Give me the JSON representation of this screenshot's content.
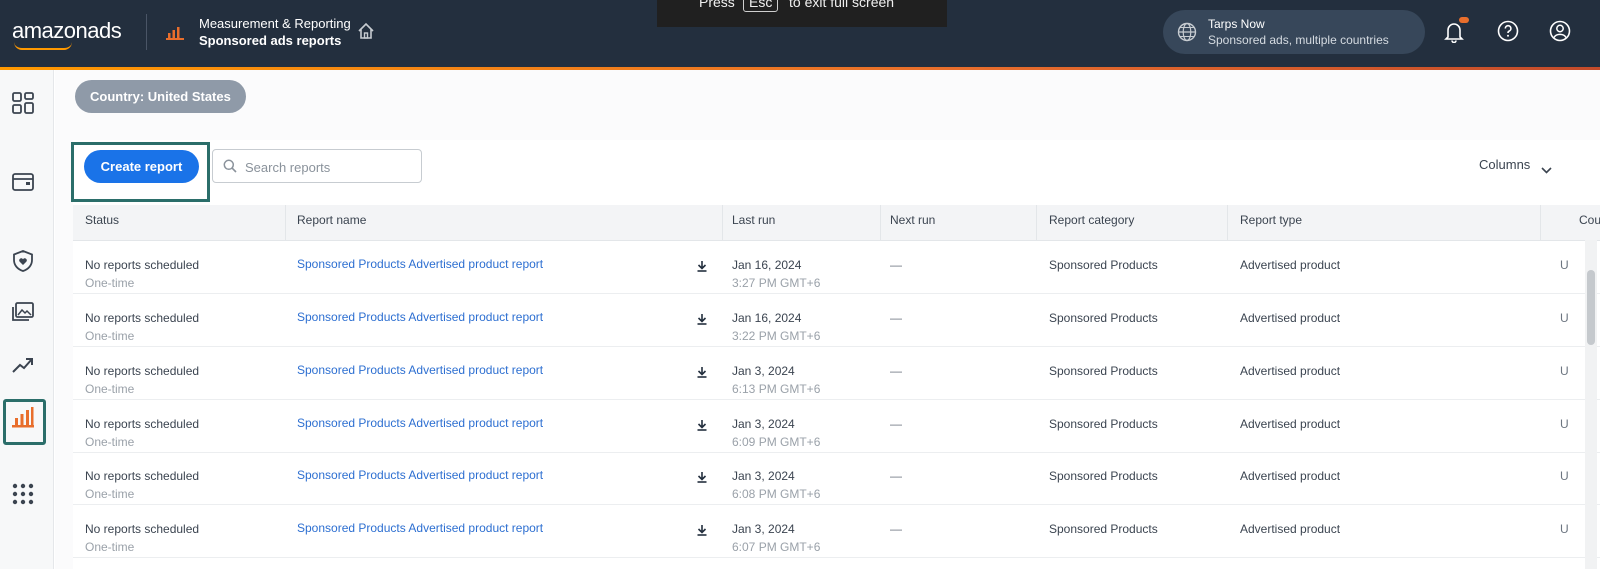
{
  "topbar": {
    "logo": "amazonads",
    "breadcrumb_parent": "Measurement & Reporting",
    "breadcrumb_current": "Sponsored ads reports",
    "fullscreen_prefix": "Press",
    "fullscreen_key": "Esc",
    "fullscreen_suffix": "to exit full screen",
    "account_name": "Tarps Now",
    "account_scope": "Sponsored ads, multiple countries",
    "accent_color": "#ff9900",
    "bg_color": "#232f3e"
  },
  "leftrail": {
    "icons": [
      "dashboard-icon",
      "wallet-icon",
      "shield-icon",
      "media-icon",
      "trend-icon",
      "reports-icon",
      "apps-grid-icon"
    ],
    "selected": "reports-icon"
  },
  "filters": {
    "country_chip": "Country: United States"
  },
  "toolbar": {
    "create_label": "Create report",
    "search_placeholder": "Search reports",
    "columns_label": "Columns"
  },
  "table": {
    "headers": [
      "Status",
      "Report name",
      "Last run",
      "Next run",
      "Report category",
      "Report type",
      "Cou"
    ],
    "rows": [
      {
        "status": "No reports scheduled",
        "frequency": "One-time",
        "name": "Sponsored Products Advertised product report",
        "date": "Jan 16, 2024",
        "time": "3:27 PM GMT+6",
        "next_run": "—",
        "category": "Sponsored Products",
        "type": "Advertised product",
        "country": "U"
      },
      {
        "status": "No reports scheduled",
        "frequency": "One-time",
        "name": "Sponsored Products Advertised product report",
        "date": "Jan 16, 2024",
        "time": "3:22 PM GMT+6",
        "next_run": "—",
        "category": "Sponsored Products",
        "type": "Advertised product",
        "country": "U"
      },
      {
        "status": "No reports scheduled",
        "frequency": "One-time",
        "name": "Sponsored Products Advertised product report",
        "date": "Jan 3, 2024",
        "time": "6:13 PM GMT+6",
        "next_run": "—",
        "category": "Sponsored Products",
        "type": "Advertised product",
        "country": "U"
      },
      {
        "status": "No reports scheduled",
        "frequency": "One-time",
        "name": "Sponsored Products Advertised product report",
        "date": "Jan 3, 2024",
        "time": "6:09 PM GMT+6",
        "next_run": "—",
        "category": "Sponsored Products",
        "type": "Advertised product",
        "country": "U"
      },
      {
        "status": "No reports scheduled",
        "frequency": "One-time",
        "name": "Sponsored Products Advertised product report",
        "date": "Jan 3, 2024",
        "time": "6:08 PM GMT+6",
        "next_run": "—",
        "category": "Sponsored Products",
        "type": "Advertised product",
        "country": "U"
      },
      {
        "status": "No reports scheduled",
        "frequency": "One-time",
        "name": "Sponsored Products Advertised product report",
        "date": "Jan 3, 2024",
        "time": "6:07 PM GMT+6",
        "next_run": "—",
        "category": "Sponsored Products",
        "type": "Advertised product",
        "country": "U"
      }
    ]
  }
}
